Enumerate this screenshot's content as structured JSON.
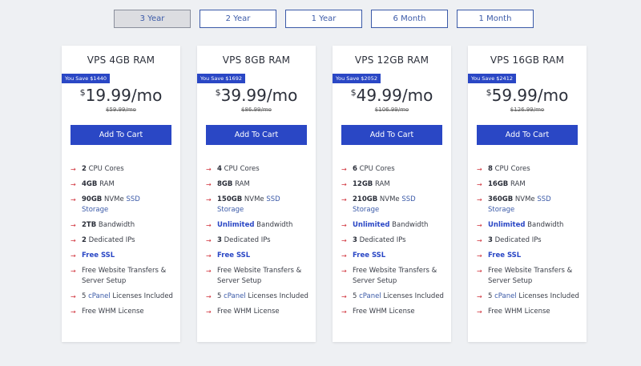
{
  "tabs": [
    "3 Year",
    "2 Year",
    "1 Year",
    "6 Month",
    "1 Month"
  ],
  "active_tab": "3 Year",
  "add_to_cart_label": "Add To Cart",
  "plans": [
    {
      "name": "VPS 4GB RAM",
      "save": "You Save $1440",
      "currency": "$",
      "price": "19.99",
      "period": "/mo",
      "old_price": "$59.99/mo",
      "cpu_n": "2",
      "cpu_t": " CPU Cores",
      "ram_n": "4GB",
      "ram_t": " RAM",
      "ssd_n": "90GB",
      "ssd_t1": " NVMe ",
      "ssd_t2": "SSD",
      "ssd_t3": "Storage",
      "bw_n": "2TB",
      "bw_t": " Bandwidth",
      "ip_n": "2",
      "ip_t": " Dedicated IPs",
      "ssl": "Free SSL",
      "transfer": "Free Website Transfers & Server Setup",
      "cp_n": "5 ",
      "cp_link": "cPanel",
      "cp_t": " Licenses Included",
      "whm": "Free WHM License"
    },
    {
      "name": "VPS 8GB RAM",
      "save": "You Save $1692",
      "currency": "$",
      "price": "39.99",
      "period": "/mo",
      "old_price": "$86.99/mo",
      "cpu_n": "4",
      "cpu_t": " CPU Cores",
      "ram_n": "8GB",
      "ram_t": " RAM",
      "ssd_n": "150GB",
      "ssd_t1": " NVMe ",
      "ssd_t2": "SSD",
      "ssd_t3": "Storage",
      "bw_n": "Unlimited",
      "bw_t": " Bandwidth",
      "ip_n": "3",
      "ip_t": " Dedicated IPs",
      "ssl": "Free SSL",
      "transfer": "Free Website Transfers & Server Setup",
      "cp_n": "5 ",
      "cp_link": "cPanel",
      "cp_t": " Licenses Included",
      "whm": "Free WHM License"
    },
    {
      "name": "VPS 12GB RAM",
      "save": "You Save $2052",
      "currency": "$",
      "price": "49.99",
      "period": "/mo",
      "old_price": "$106.99/mo",
      "cpu_n": "6",
      "cpu_t": " CPU Cores",
      "ram_n": "12GB",
      "ram_t": " RAM",
      "ssd_n": "210GB",
      "ssd_t1": " NVMe ",
      "ssd_t2": "SSD",
      "ssd_t3": "Storage",
      "bw_n": "Unlimited",
      "bw_t": " Bandwidth",
      "ip_n": "3",
      "ip_t": " Dedicated IPs",
      "ssl": "Free SSL",
      "transfer": "Free Website Transfers & Server Setup",
      "cp_n": "5 ",
      "cp_link": "cPanel",
      "cp_t": " Licenses Included",
      "whm": "Free WHM License"
    },
    {
      "name": "VPS 16GB RAM",
      "save": "You Save $2412",
      "currency": "$",
      "price": "59.99",
      "period": "/mo",
      "old_price": "$126.99/mo",
      "cpu_n": "8",
      "cpu_t": " CPU Cores",
      "ram_n": "16GB",
      "ram_t": " RAM",
      "ssd_n": "360GB",
      "ssd_t1": " NVMe ",
      "ssd_t2": "SSD",
      "ssd_t3": "Storage",
      "bw_n": "Unlimited",
      "bw_t": " Bandwidth",
      "ip_n": "3",
      "ip_t": " Dedicated IPs",
      "ssl": "Free SSL",
      "transfer": "Free Website Transfers & Server Setup",
      "cp_n": "5 ",
      "cp_link": "cPanel",
      "cp_t": " Licenses Included",
      "whm": "Free WHM License"
    }
  ],
  "colors": {
    "accent": "#2a47c5",
    "arrow": "#d0313a",
    "link": "#3b5aa8",
    "background": "#eef0f3"
  },
  "icons": {
    "feature_bullet": "arrow-right-icon"
  }
}
